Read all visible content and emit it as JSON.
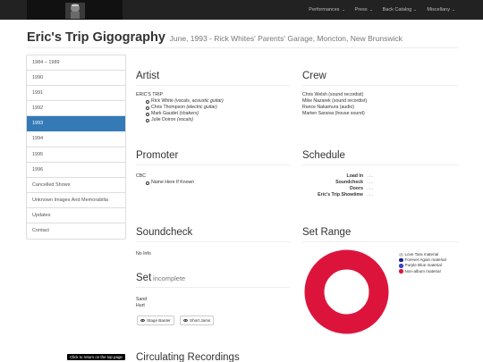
{
  "navbar": {
    "items": [
      {
        "label": "Performances"
      },
      {
        "label": "Press"
      },
      {
        "label": "Back Catalog"
      },
      {
        "label": "Miscellany"
      }
    ]
  },
  "header": {
    "title": "Eric's Trip Gigography",
    "subtitle": "June, 1993 - Rick Whites' Parents' Garage, Moncton, New Brunswick"
  },
  "sidebar": {
    "items": [
      {
        "label": "1984 – 1989"
      },
      {
        "label": "1990"
      },
      {
        "label": "1991"
      },
      {
        "label": "1992"
      },
      {
        "label": "1993",
        "active": true
      },
      {
        "label": "1994"
      },
      {
        "label": "1995"
      },
      {
        "label": "1996"
      },
      {
        "label": "Cancelled Shows"
      },
      {
        "label": "Unknown Images And Memorabilia"
      },
      {
        "label": "Updates"
      },
      {
        "label": "Contact"
      }
    ]
  },
  "artist": {
    "heading": "Artist",
    "band": "ERIC'S TRIP",
    "members": [
      {
        "name": "Rick White",
        "role": "(vocals, acoustic guitar)"
      },
      {
        "name": "Chris Thompson",
        "role": "(electric guitar)"
      },
      {
        "name": "Mark Gaudet",
        "role": "(shakers)"
      },
      {
        "name": "Julie Doiron",
        "role": "(vocals)"
      }
    ]
  },
  "crew": {
    "heading": "Crew",
    "members": [
      "Chris Welsh (sound recordist)",
      "Mike Nazarek (sound recordist)",
      "Rance Nakamura (audio)",
      "Marten Saraiva (house sound)"
    ]
  },
  "promoter": {
    "heading": "Promoter",
    "name": "CBC",
    "items": [
      "Name Here If Known"
    ]
  },
  "schedule": {
    "heading": "Schedule",
    "rows": [
      {
        "label": "Load In",
        "value": "..:.."
      },
      {
        "label": "Soundcheck",
        "value": "..:.."
      },
      {
        "label": "Doors",
        "value": "..:.."
      },
      {
        "label": "Eric's Trip Showtime",
        "value": "..:.."
      }
    ]
  },
  "soundcheck": {
    "heading": "Soundcheck",
    "text": "No Info"
  },
  "set": {
    "heading": "Set",
    "status": "incomplete",
    "songs": [
      "Sand",
      "Hurt"
    ],
    "buttons": [
      "Stage Banter",
      "Short Jams"
    ]
  },
  "set_range": {
    "heading": "Set Range",
    "legend": [
      {
        "label": "Love Tara material",
        "color": "#cccccc"
      },
      {
        "label": "Forever Again material",
        "color": "#1f1f8f"
      },
      {
        "label": "Purple Blue material",
        "color": "#3344cc"
      },
      {
        "label": "Non-album material",
        "color": "#dc143c"
      }
    ],
    "slices": [
      {
        "label": "Non-album material",
        "value": 100,
        "color": "#dc143c"
      }
    ]
  },
  "circulating": {
    "heading": "Circulating Recordings"
  },
  "tooltip": {
    "text": "Click to return on the top page"
  }
}
